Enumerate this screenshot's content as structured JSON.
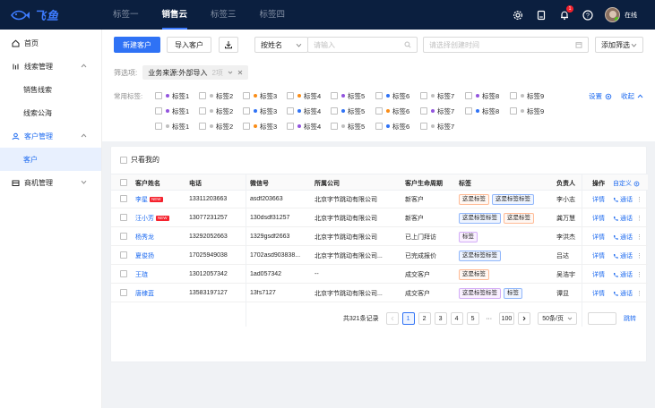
{
  "brand": {
    "name": "飞鱼",
    "accent": "#3d7bff"
  },
  "top_tabs": [
    {
      "label": "标签一",
      "active": false
    },
    {
      "label": "销售云",
      "active": true
    },
    {
      "label": "标签三",
      "active": false
    },
    {
      "label": "标签四",
      "active": false
    }
  ],
  "top_right": {
    "notification_count": "1",
    "user_status": "在线"
  },
  "sidebar": {
    "home": "首页",
    "leads": "线索管理",
    "leads_sales": "销售线索",
    "leads_public": "线索公海",
    "customer_mgmt": "客户管理",
    "customer": "客户",
    "opportunity": "商机管理"
  },
  "toolbar": {
    "new_customer": "新建客户",
    "import_customer": "导入客户",
    "search_field": "按姓名",
    "search_placeholder": "请输入",
    "date_placeholder": "请选择创建时间",
    "add_filter": "添加筛选"
  },
  "filters": {
    "label": "筛选项:",
    "tag_text": "业务来源:外部导入",
    "tag_count": "2项"
  },
  "common_tags": {
    "label": "常用标签:",
    "settings": "设置",
    "collapse": "收起",
    "row1": [
      {
        "label": "标签1",
        "color": "#9254de"
      },
      {
        "label": "标签2",
        "color": "#bfbfbf"
      },
      {
        "label": "标签3",
        "color": "#fa8c16"
      },
      {
        "label": "标签4",
        "color": "#fa8c16"
      },
      {
        "label": "标签5",
        "color": "#9254de"
      },
      {
        "label": "标签6",
        "color": "#2f72f5"
      },
      {
        "label": "标签7",
        "color": "#bfbfbf"
      },
      {
        "label": "标签8",
        "color": "#9254de"
      },
      {
        "label": "标签9",
        "color": "#bfbfbf"
      }
    ],
    "row2": [
      {
        "label": "标签1",
        "color": "#9254de"
      },
      {
        "label": "标签2",
        "color": "#bfbfbf"
      },
      {
        "label": "标签3",
        "color": "#2f72f5"
      },
      {
        "label": "标签4",
        "color": "#2f72f5"
      },
      {
        "label": "标签5",
        "color": "#2f72f5"
      },
      {
        "label": "标签6",
        "color": "#fa8c16"
      },
      {
        "label": "标签7",
        "color": "#9254de"
      },
      {
        "label": "标签8",
        "color": "#2f72f5"
      },
      {
        "label": "标签9",
        "color": "#bfbfbf"
      }
    ],
    "row3": [
      {
        "label": "标签1",
        "color": "#bfbfbf"
      },
      {
        "label": "标签2",
        "color": "#bfbfbf"
      },
      {
        "label": "标签3",
        "color": "#fa8c16"
      },
      {
        "label": "标签4",
        "color": "#9254de"
      },
      {
        "label": "标签5",
        "color": "#bfbfbf"
      },
      {
        "label": "标签6",
        "color": "#2f72f5"
      },
      {
        "label": "标签7",
        "color": "#bfbfbf"
      }
    ]
  },
  "table": {
    "only_mine": "只看我的",
    "headers": {
      "name": "客户姓名",
      "phone": "电话",
      "wechat": "微信号",
      "company": "所属公司",
      "lifecycle": "客户生命周期",
      "tags": "标签",
      "owner": "负责人",
      "ops": "操作",
      "customize": "自定义"
    },
    "new_badge": "NEW",
    "detail": "详情",
    "call": "通话",
    "rows": [
      {
        "name": "李星",
        "new": true,
        "phone": "13311203663",
        "wechat": "asdf203663",
        "company": "北京字节跳动有限公司",
        "lifecycle": "新客户",
        "tags": [
          {
            "t": "这是标签",
            "c": "orange"
          },
          {
            "t": "这是标签标签",
            "c": "blue"
          }
        ],
        "owner": "李小志"
      },
      {
        "name": "汪小芳",
        "new": true,
        "phone": "13077231257",
        "wechat": "130dsdf31257",
        "company": "北京字节跳动有限公司",
        "lifecycle": "新客户",
        "tags": [
          {
            "t": "这是标签标签",
            "c": "blue"
          },
          {
            "t": "这是标签",
            "c": "orange"
          }
        ],
        "owner": "龚万慧"
      },
      {
        "name": "杨秀龙",
        "new": false,
        "phone": "13292052663",
        "wechat": "1329gsdf2663",
        "company": "北京字节跳动有限公司",
        "lifecycle": "已上门拜访",
        "tags": [
          {
            "t": "标签",
            "c": "purple"
          }
        ],
        "owner": "李洪杰"
      },
      {
        "name": "夏俊扬",
        "new": false,
        "phone": "17025949038",
        "wechat": "1702asd903838...",
        "company": "北京字节跳动有限公司...",
        "lifecycle": "已完成报价",
        "tags": [
          {
            "t": "这是标签标签",
            "c": "blue"
          }
        ],
        "owner": "吕达"
      },
      {
        "name": "王琏",
        "new": false,
        "phone": "13012057342",
        "wechat": "1ad057342",
        "company": "--",
        "lifecycle": "成交客户",
        "tags": [
          {
            "t": "这是标签",
            "c": "orange"
          }
        ],
        "owner": "吴浩宇"
      },
      {
        "name": "唐棣蓝",
        "new": false,
        "phone": "13583197127",
        "wechat": "13fs7127",
        "company": "北京字节跳动有限公司...",
        "lifecycle": "成交客户",
        "tags": [
          {
            "t": "这是标签标签",
            "c": "purple"
          },
          {
            "t": "标签",
            "c": "gray"
          }
        ],
        "owner": "谭显"
      }
    ]
  },
  "pagination": {
    "total": "共321条记录",
    "pages": [
      "1",
      "2",
      "3",
      "4",
      "5",
      "···",
      "100"
    ],
    "current": "1",
    "page_size": "50条/页",
    "jump": "跳转"
  }
}
